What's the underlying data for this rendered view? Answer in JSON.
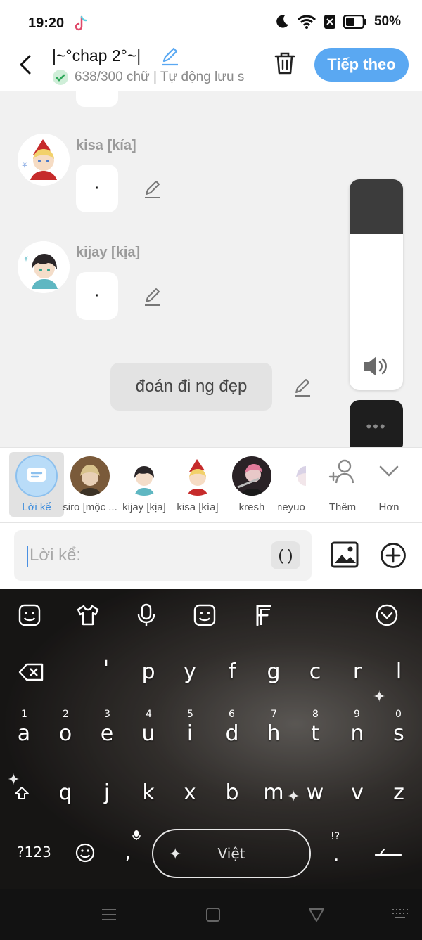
{
  "status_bar": {
    "time": "19:20",
    "battery": "50%"
  },
  "header": {
    "title": "|~°chap 2°~|",
    "subtitle": "638/300 chữ | Tự động lưu s",
    "next_label": "Tiếp theo"
  },
  "chat": {
    "messages": [
      {
        "name": "kisa [kía]",
        "text": "·"
      },
      {
        "name": "kijay [kịa]",
        "text": "·"
      }
    ],
    "narration": "đoán đi ng đẹp"
  },
  "volume": {
    "level_fraction": 0.26
  },
  "characters": [
    {
      "label": "Lời kể",
      "selected": true
    },
    {
      "label": "siro [mộc ..."
    },
    {
      "label": "kijay [kịa]"
    },
    {
      "label": "kisa [kía]"
    },
    {
      "label": "kresh"
    },
    {
      "label": "neyuo"
    },
    {
      "label": "Thêm"
    },
    {
      "label": "Hơn"
    }
  ],
  "input": {
    "placeholder": "Lời kể:",
    "paren_label": "( )"
  },
  "keyboard": {
    "row1": [
      "'",
      "p",
      "y",
      "f",
      "g",
      "c",
      "r",
      "l"
    ],
    "row2": [
      "a",
      "o",
      "e",
      "u",
      "i",
      "d",
      "h",
      "t",
      "n",
      "s"
    ],
    "row2_numbers": [
      "1",
      "2",
      "3",
      "4",
      "5",
      "6",
      "7",
      "8",
      "9",
      "0"
    ],
    "row3": [
      "q",
      "j",
      "k",
      "x",
      "b",
      "m",
      "w",
      "v",
      "z"
    ],
    "symbols_label": "?123",
    "comma": ",",
    "space_label": "Việt",
    "period": ".",
    "punct_hint": "!?"
  },
  "colors": {
    "accent": "#5aa8f2",
    "label_selected": "#3f8ddc"
  }
}
